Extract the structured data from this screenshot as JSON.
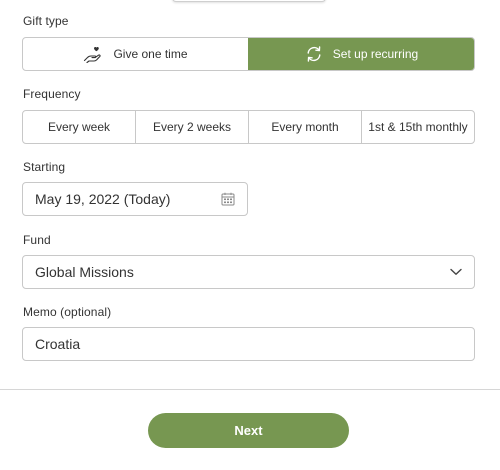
{
  "gift_type": {
    "label": "Gift type",
    "options": [
      {
        "label": "Give one time",
        "icon": "hand-heart-icon",
        "selected": false
      },
      {
        "label": "Set up recurring",
        "icon": "recurring-arrows-icon",
        "selected": true
      }
    ]
  },
  "frequency": {
    "label": "Frequency",
    "options": [
      {
        "label": "Every week"
      },
      {
        "label": "Every 2 weeks"
      },
      {
        "label": "Every month"
      },
      {
        "label": "1st & 15th monthly"
      }
    ]
  },
  "starting": {
    "label": "Starting",
    "value": "May 19, 2022 (Today)",
    "icon": "calendar-icon"
  },
  "fund": {
    "label": "Fund",
    "value": "Global Missions",
    "icon": "chevron-down-icon"
  },
  "memo": {
    "label": "Memo (optional)",
    "value": "Croatia"
  },
  "actions": {
    "next_label": "Next"
  },
  "colors": {
    "accent": "#779751",
    "border": "#c8c8c8",
    "text": "#333333"
  }
}
